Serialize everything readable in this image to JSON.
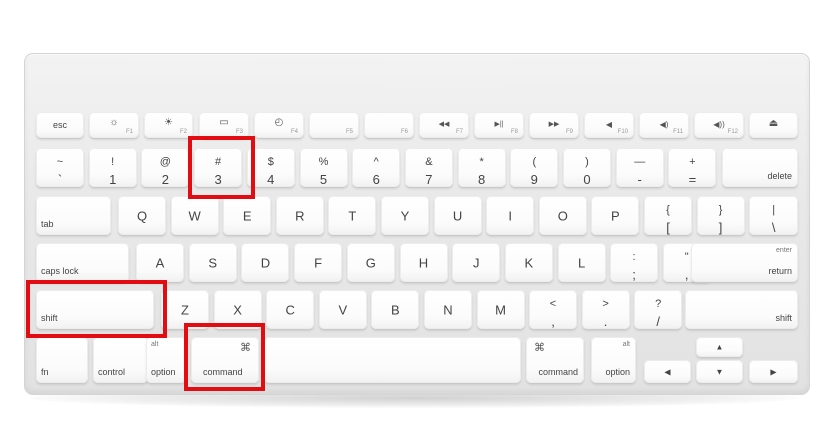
{
  "function_row": {
    "esc": "esc",
    "f1_label": "F1",
    "f1_icon": "☼",
    "f2_label": "F2",
    "f2_icon": "☀",
    "f3_label": "F3",
    "f3_icon": "▭",
    "f4_label": "F4",
    "f4_icon": "◴",
    "f5_label": "F5",
    "f6_label": "F6",
    "f7_label": "F7",
    "f7_icon": "◀◀",
    "f8_label": "F8",
    "f8_icon": "▶||",
    "f9_label": "F9",
    "f9_icon": "▶▶",
    "f10_label": "F10",
    "f10_icon": "◀",
    "f11_label": "F11",
    "f11_icon": "◀)",
    "f12_label": "F12",
    "f12_icon": "◀))",
    "eject_icon": "⏏"
  },
  "number_row": [
    {
      "top": "~",
      "main": "`"
    },
    {
      "top": "!",
      "main": "1"
    },
    {
      "top": "@",
      "main": "2"
    },
    {
      "top": "#",
      "main": "3"
    },
    {
      "top": "$",
      "main": "4"
    },
    {
      "top": "%",
      "main": "5"
    },
    {
      "top": "^",
      "main": "6"
    },
    {
      "top": "&",
      "main": "7"
    },
    {
      "top": "*",
      "main": "8"
    },
    {
      "top": "(",
      "main": "9"
    },
    {
      "top": ")",
      "main": "0"
    },
    {
      "top": "—",
      "main": "-"
    },
    {
      "top": "+",
      "main": "="
    }
  ],
  "delete": "delete",
  "tab": "tab",
  "row_q": [
    "Q",
    "W",
    "E",
    "R",
    "T",
    "Y",
    "U",
    "I",
    "O",
    "P"
  ],
  "row_q_brackets": [
    {
      "top": "{",
      "main": "["
    },
    {
      "top": "}",
      "main": "]"
    },
    {
      "top": "|",
      "main": "\\"
    }
  ],
  "caps_lock": "caps lock",
  "row_a": [
    "A",
    "S",
    "D",
    "F",
    "G",
    "H",
    "J",
    "K",
    "L"
  ],
  "row_a_punct": [
    {
      "top": ":",
      "main": ";"
    },
    {
      "top": "\"",
      "main": ","
    }
  ],
  "enter": "enter",
  "return": "return",
  "shift_left": "shift",
  "row_z": [
    "Z",
    "X",
    "C",
    "V",
    "B",
    "N",
    "M"
  ],
  "row_z_punct": [
    {
      "top": "<",
      "main": ","
    },
    {
      "top": ">",
      "main": "."
    },
    {
      "top": "?",
      "main": "/"
    }
  ],
  "shift_right": "shift",
  "fn": "fn",
  "control": "control",
  "alt": "alt",
  "option": "option",
  "cmd_glyph": "⌘",
  "command": "command",
  "arrow_up": "▲",
  "arrow_left": "◀",
  "arrow_down": "▼",
  "arrow_right": "▶",
  "highlight_color": "#e10d12"
}
